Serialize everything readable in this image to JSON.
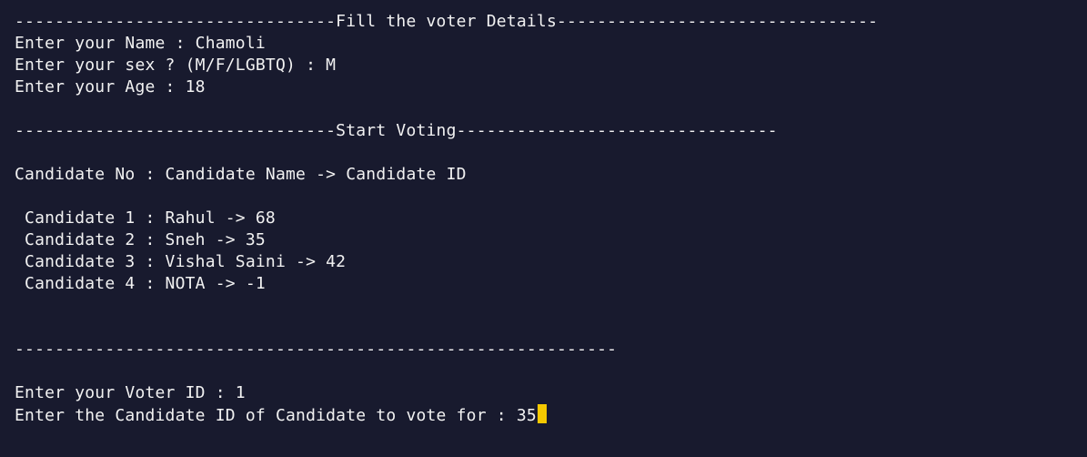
{
  "terminal": {
    "background": "#181a2e",
    "text_color": "#f2f2f2",
    "cursor_color": "#f5c800",
    "voter_header": "--------------------------------Fill the voter Details--------------------------------",
    "name_line": "Enter your Name : Chamoli",
    "sex_line": "Enter your sex ? (M/F/LGBTQ) : M",
    "age_line": "Enter your Age : 18",
    "voting_header": "--------------------------------Start Voting--------------------------------",
    "candidate_table_header": "Candidate No : Candidate Name -> Candidate ID",
    "candidates": [
      " Candidate 1 : Rahul -> 68",
      " Candidate 2 : Sneh -> 35",
      " Candidate 3 : Vishal Saini -> 42",
      " Candidate 4 : NOTA -> -1"
    ],
    "separator": "------------------------------------------------------------",
    "voter_id_line": "Enter your Voter ID : 1",
    "vote_prompt_line": "Enter the Candidate ID of Candidate to vote for : 35"
  }
}
